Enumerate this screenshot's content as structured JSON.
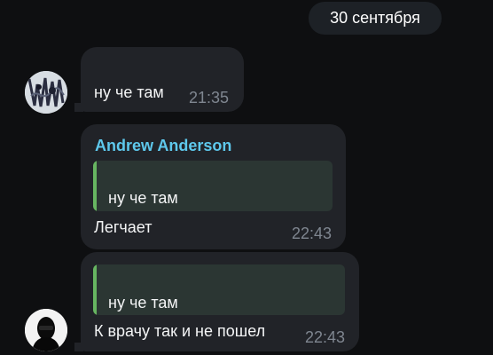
{
  "date_divider": "30 сентября",
  "messages": [
    {
      "text": "ну че там",
      "time": "21:35"
    },
    {
      "sender": "Andrew Anderson",
      "reply": "ну че там",
      "text": "Легчает",
      "time": "22:43"
    },
    {
      "reply": "ну че там",
      "text": "К врачу так и не пошел",
      "time": "22:43"
    }
  ]
}
